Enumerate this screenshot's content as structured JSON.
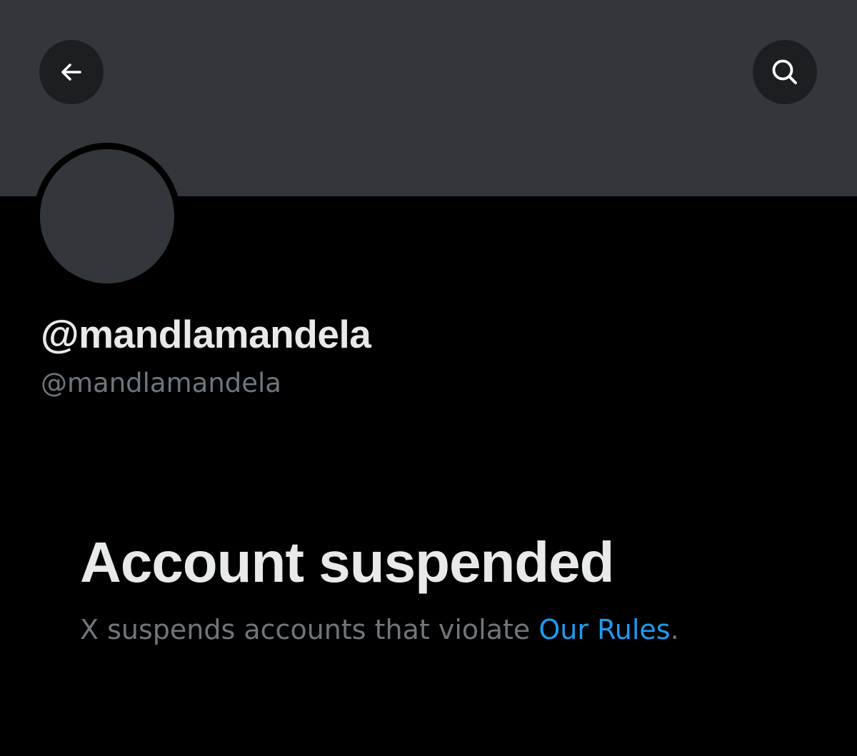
{
  "header": {
    "back_icon": "arrow-left-icon",
    "search_icon": "search-icon",
    "banner_color": "#33363b"
  },
  "profile": {
    "display_name": "@mandlamandela",
    "handle": "@mandlamandela",
    "avatar_color": "#33363b"
  },
  "suspension": {
    "title": "Account suspended",
    "description_prefix": "X suspends accounts that violate ",
    "link_text": "Our Rules",
    "description_suffix": ".",
    "link_color": "#1d9bf0"
  }
}
